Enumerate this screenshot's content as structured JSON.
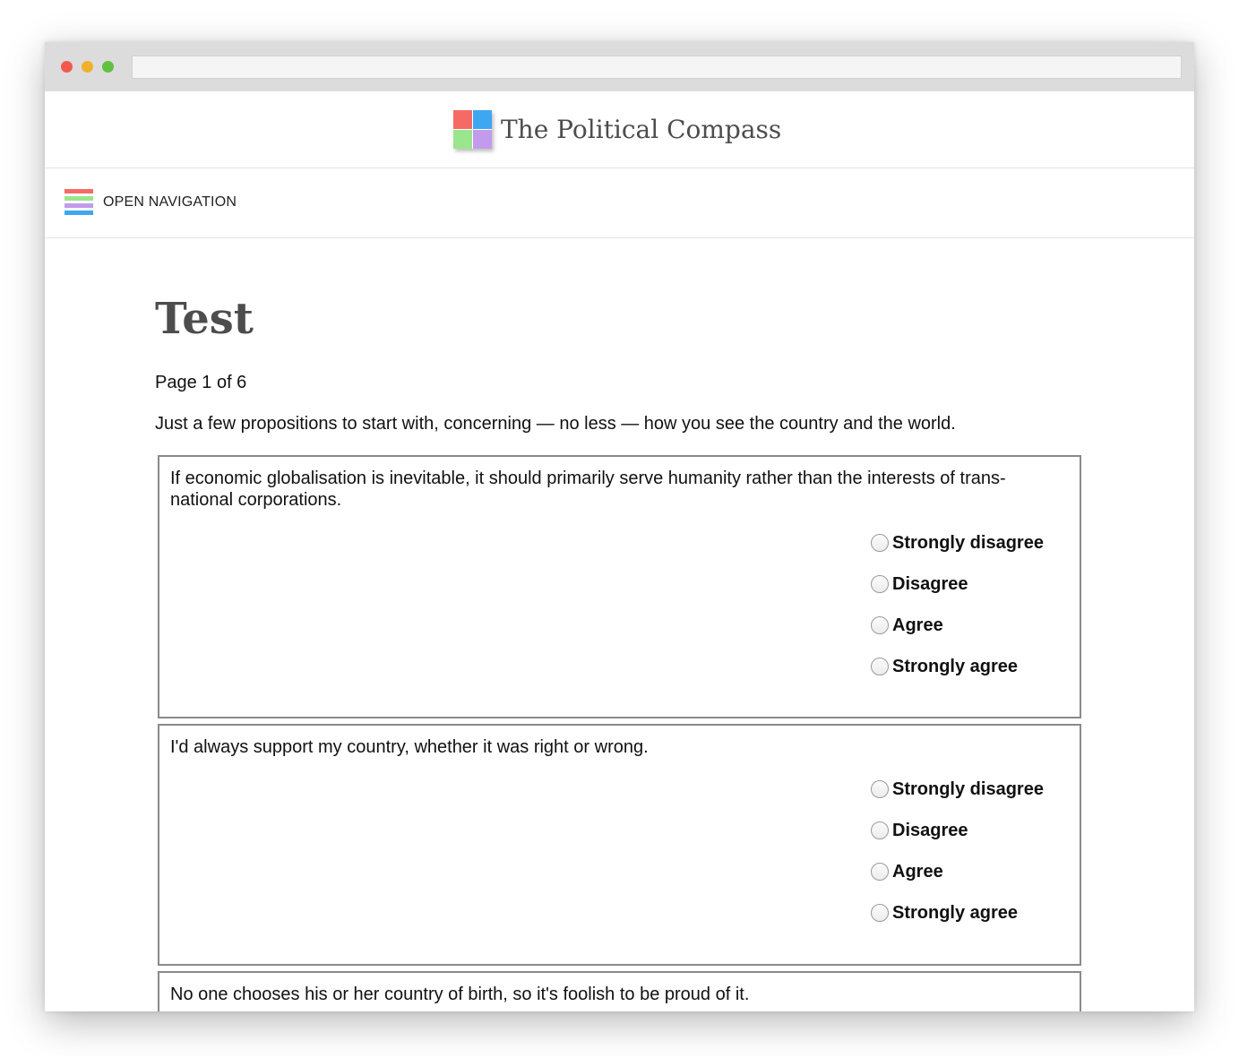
{
  "brand": {
    "name": "The Political Compass",
    "logo_colors": [
      "#f66a66",
      "#3ea7f2",
      "#9ae58d",
      "#c29bec"
    ]
  },
  "nav": {
    "label": "OPEN NAVIGATION",
    "icon": "hamburger-menu-icon",
    "stripe_colors": [
      "#f66a66",
      "#9ae58d",
      "#c29bec",
      "#3ea7f2"
    ]
  },
  "page": {
    "title": "Test",
    "indicator": "Page 1 of 6",
    "intro": "Just a few propositions to start with, concerning — no less — how you see the country and the world."
  },
  "answer_options": [
    "Strongly disagree",
    "Disagree",
    "Agree",
    "Strongly agree"
  ],
  "questions": [
    {
      "text": "If economic globalisation is inevitable, it should primarily serve humanity rather than the interests of trans-national corporations."
    },
    {
      "text": "I'd always support my country, whether it was right or wrong."
    },
    {
      "text": "No one chooses his or her country of birth, so it's foolish to be proud of it."
    }
  ]
}
